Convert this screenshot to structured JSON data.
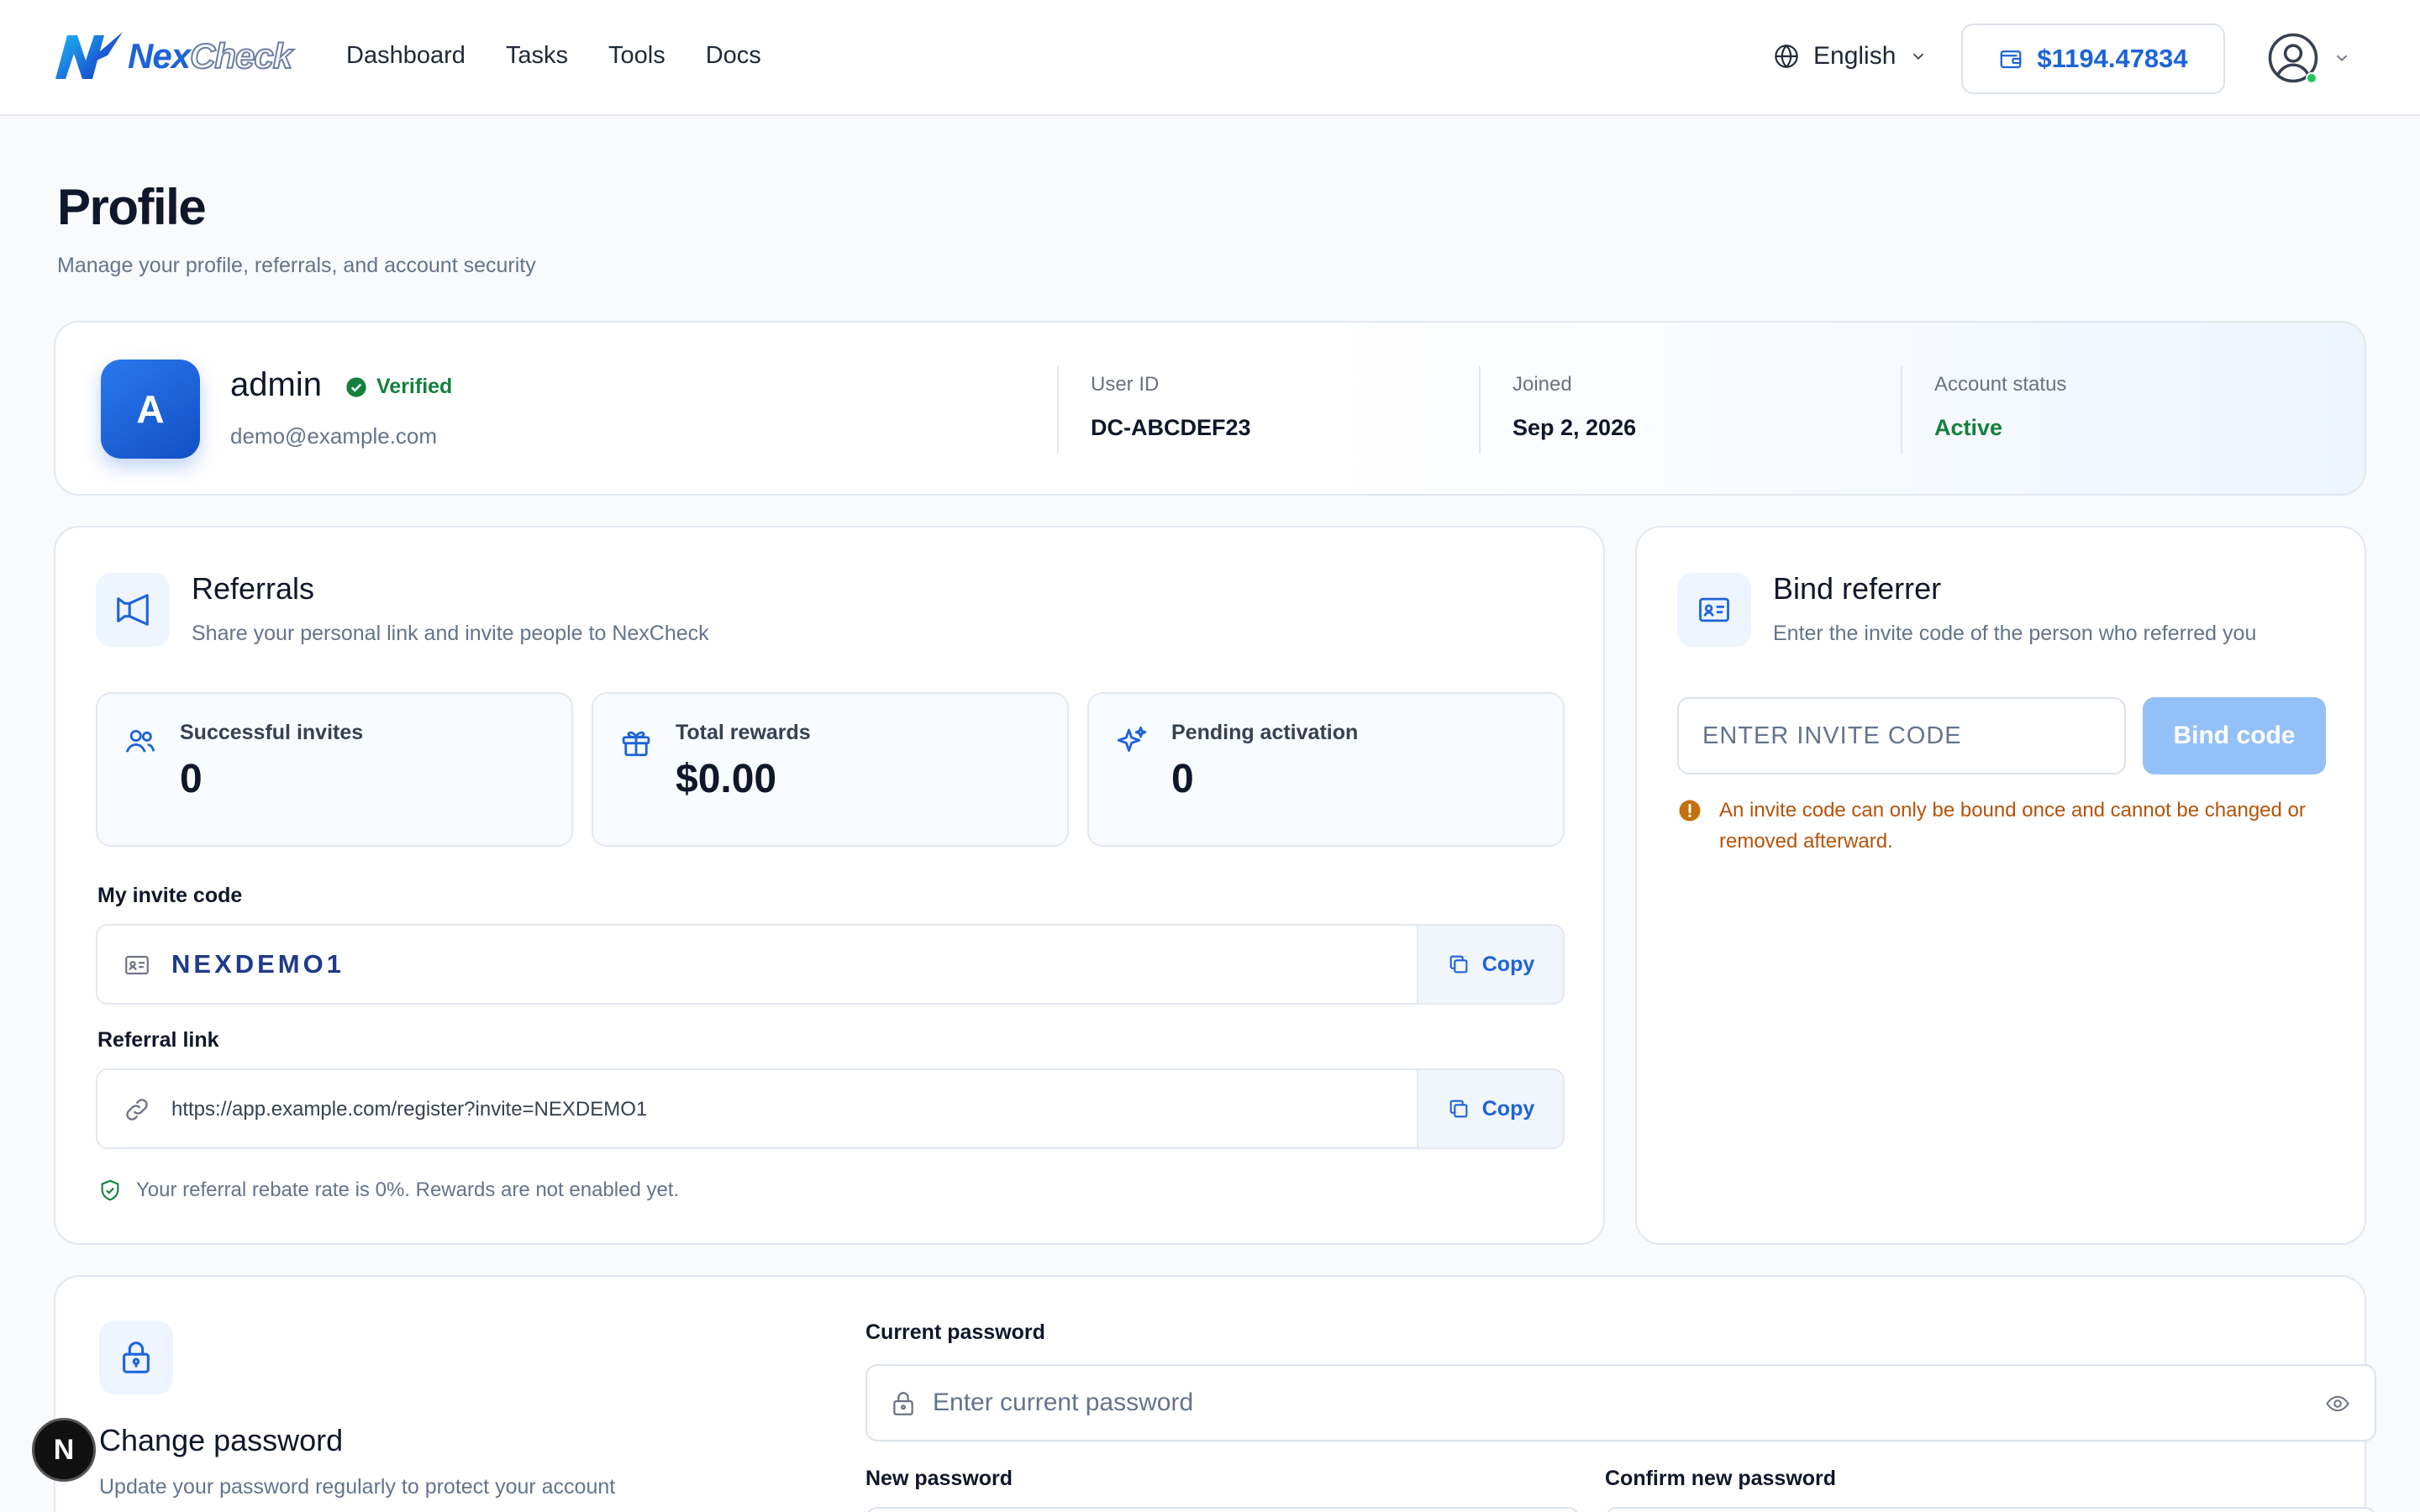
{
  "brand": {
    "name_part1": "Nex",
    "name_part2": "Check",
    "accent": "#1d63d8"
  },
  "nav": {
    "items": [
      "Dashboard",
      "Tasks",
      "Tools",
      "Docs"
    ]
  },
  "header": {
    "language": "English",
    "language_icon": "globe-icon",
    "balance": "$1194.47834",
    "balance_icon": "wallet-icon",
    "user_icon": "user-circle-icon"
  },
  "page": {
    "title": "Profile",
    "subtitle": "Manage your profile, referrals, and account security"
  },
  "profile": {
    "avatar_letter": "A",
    "username": "admin",
    "verified_label": "Verified",
    "email": "demo@example.com",
    "user_id_label": "User ID",
    "user_id": "DC-ABCDEF23",
    "joined_label": "Joined",
    "joined": "Sep 2, 2026",
    "status_label": "Account status",
    "status": "Active",
    "status_color": "#15803d"
  },
  "referrals": {
    "title": "Referrals",
    "subtitle": "Share your personal link and invite people to NexCheck",
    "stats": [
      {
        "label": "Successful invites",
        "value": "0",
        "icon": "users-icon"
      },
      {
        "label": "Total rewards",
        "value": "$0.00",
        "icon": "gift-icon"
      },
      {
        "label": "Pending activation",
        "value": "0",
        "icon": "sparkles-icon"
      }
    ],
    "invite_code_label": "My invite code",
    "invite_code": "NEXDEMO1",
    "link_label": "Referral link",
    "link": "https://app.example.com/register?invite=NEXDEMO1",
    "copy_label": "Copy",
    "rebate_note": "Your referral rebate rate is 0%. Rewards are not enabled yet."
  },
  "bind": {
    "title": "Bind referrer",
    "subtitle": "Enter the invite code of the person who referred you",
    "placeholder": "ENTER INVITE CODE",
    "button": "Bind code",
    "warning": "An invite code can only be bound once and cannot be changed or removed afterward.",
    "warning_color": "#b45309"
  },
  "password": {
    "title": "Change password",
    "subtitle": "Update your password regularly to protect your account",
    "current_label": "Current password",
    "current_placeholder": "Enter current password",
    "new_label": "New password",
    "confirm_label": "Confirm new password"
  },
  "fab": {
    "letter": "N"
  }
}
